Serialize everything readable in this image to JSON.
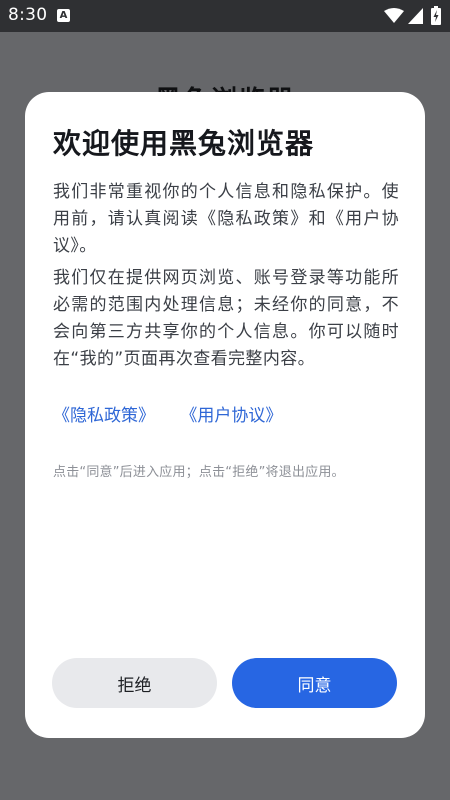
{
  "status_bar": {
    "time": "8:30",
    "notification_icon_letter": "A",
    "icons": [
      "wifi-icon",
      "signal-icon",
      "battery-icon"
    ]
  },
  "background": {
    "title": "黑兔浏览器"
  },
  "dialog": {
    "title": "欢迎使用黑兔浏览器",
    "paragraph_1": "我们非常重视你的个人信息和隐私保护。使用前，请认真阅读《隐私政策》和《用户协议》。",
    "paragraph_2": "我们仅在提供网页浏览、账号登录等功能所必需的范围内处理信息；未经你的同意，不会向第三方共享你的个人信息。你可以随时在“我的”页面再次查看完整内容。",
    "links": {
      "privacy_policy": "《隐私政策》",
      "user_agreement": "《用户协议》"
    },
    "hint": "点击“同意”后进入应用；点击“拒绝”将退出应用。",
    "buttons": {
      "reject": "拒绝",
      "agree": "同意"
    }
  },
  "colors": {
    "primary": "#2766e3",
    "link": "#2f67d6",
    "overlay": "#66676a",
    "status_bar": "#2f3033"
  }
}
